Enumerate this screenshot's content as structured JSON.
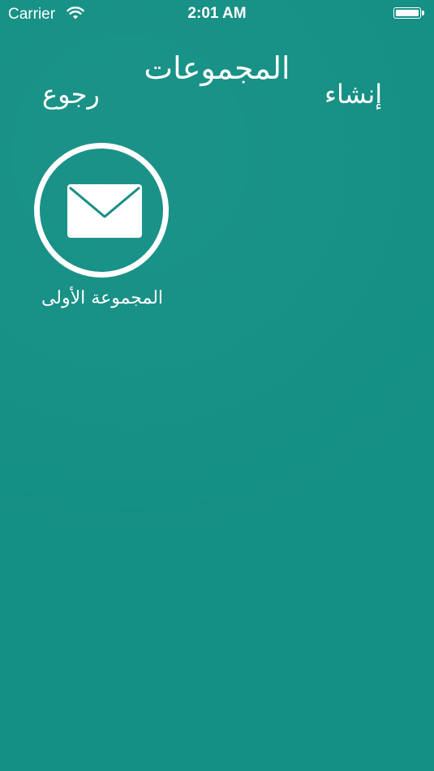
{
  "status_bar": {
    "carrier": "Carrier",
    "time": "2:01 AM"
  },
  "nav": {
    "title": "المجموعات",
    "back_label": "رجوع",
    "create_label": "إنشاء"
  },
  "groups": [
    {
      "label": "المجموعة الأولى",
      "icon": "envelope-icon"
    }
  ],
  "colors": {
    "background": "#148f84",
    "foreground": "#ffffff"
  }
}
